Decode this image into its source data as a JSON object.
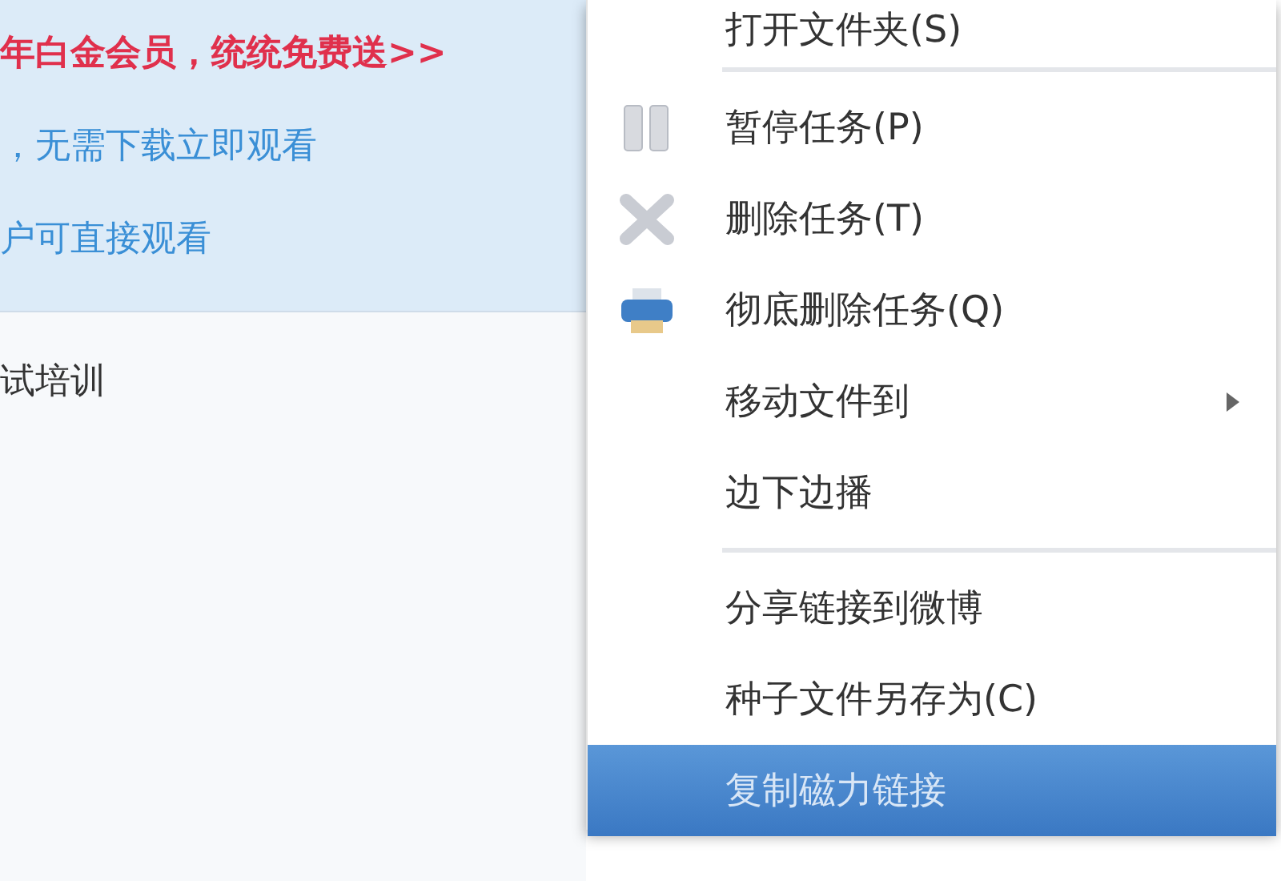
{
  "banner": {
    "promo": "年白金会员，统统免费送>>",
    "lines": [
      "，无需下载立即观看",
      "户可直接观看"
    ]
  },
  "list": {
    "rows": [
      "试培训"
    ]
  },
  "context_menu": {
    "items": [
      {
        "kind": "item",
        "label": "打开文件夹(S)",
        "selected": false,
        "submenu": false
      },
      {
        "kind": "separator"
      },
      {
        "kind": "item",
        "label": "暂停任务(P)",
        "selected": false,
        "submenu": false
      },
      {
        "kind": "item",
        "label": "删除任务(T)",
        "selected": false,
        "submenu": false
      },
      {
        "kind": "item",
        "label": "彻底删除任务(Q)",
        "selected": false,
        "submenu": false
      },
      {
        "kind": "item",
        "label": "移动文件到",
        "selected": false,
        "submenu": true
      },
      {
        "kind": "item",
        "label": "边下边播",
        "selected": false,
        "submenu": false
      },
      {
        "kind": "separator"
      },
      {
        "kind": "item",
        "label": "分享链接到微博",
        "selected": false,
        "submenu": false
      },
      {
        "kind": "item",
        "label": "种子文件另存为(C)",
        "selected": false,
        "submenu": false
      },
      {
        "kind": "item",
        "label": "复制磁力链接",
        "selected": true,
        "submenu": false
      }
    ]
  }
}
